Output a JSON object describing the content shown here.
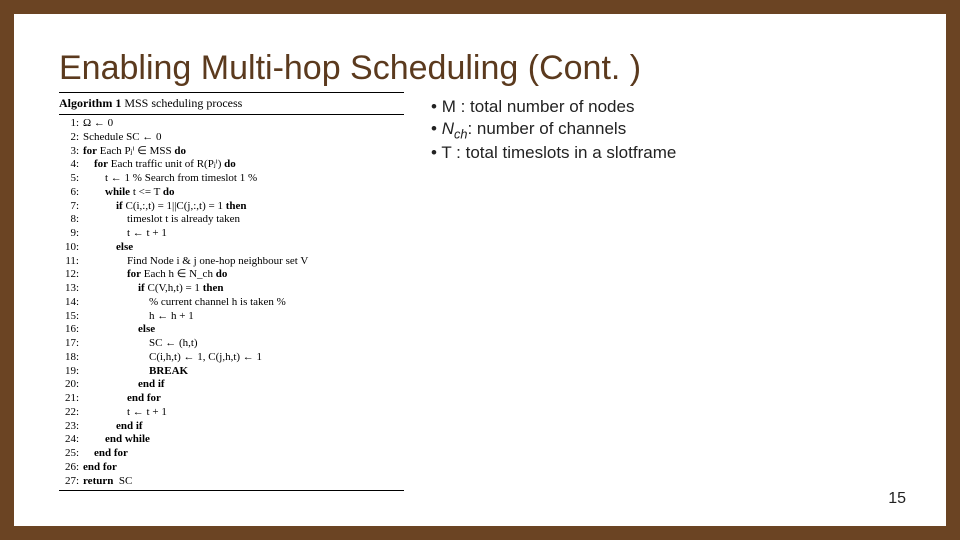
{
  "title": "Enabling Multi-hop Scheduling (Cont. )",
  "slide_number": "15",
  "legend": {
    "m": "M : total number of nodes",
    "nch_sym": "N",
    "nch_sub": "ch",
    "nch_rest": ": number of channels",
    "t": "T : total timeslots in a slotframe"
  },
  "algorithm": {
    "caption_bold": "Algorithm 1",
    "caption_rest": " MSS scheduling process",
    "lines": [
      {
        "n": "1:",
        "i": 0,
        "t": "Ω ← 0"
      },
      {
        "n": "2:",
        "i": 0,
        "t": "Schedule SC ← 0"
      },
      {
        "n": "3:",
        "i": 0,
        "pre": "for",
        "mid": " Each Pⱼⁱ ∈ MSS ",
        "post": "do"
      },
      {
        "n": "4:",
        "i": 1,
        "pre": "for",
        "mid": " Each traffic unit of R(Pⱼⁱ) ",
        "post": "do"
      },
      {
        "n": "5:",
        "i": 2,
        "t": "t ← 1 % Search from timeslot 1 %"
      },
      {
        "n": "6:",
        "i": 2,
        "pre": "while",
        "mid": " t <= T ",
        "post": "do"
      },
      {
        "n": "7:",
        "i": 3,
        "pre": "if",
        "mid": " C(i,:,t) = 1||C(j,:,t) = 1 ",
        "post": "then"
      },
      {
        "n": "8:",
        "i": 4,
        "t": "timeslot t is already taken"
      },
      {
        "n": "9:",
        "i": 4,
        "t": "t ← t + 1"
      },
      {
        "n": "10:",
        "i": 3,
        "pre": "else",
        "mid": "",
        "post": ""
      },
      {
        "n": "11:",
        "i": 4,
        "t": "Find Node i & j one-hop neighbour set V"
      },
      {
        "n": "12:",
        "i": 4,
        "pre": "for",
        "mid": " Each h ∈ N_ch ",
        "post": "do"
      },
      {
        "n": "13:",
        "i": 5,
        "pre": "if",
        "mid": " C(V,h,t) = 1 ",
        "post": "then"
      },
      {
        "n": "14:",
        "i": 6,
        "t": "% current channel h is taken %"
      },
      {
        "n": "15:",
        "i": 6,
        "t": "h ← h + 1"
      },
      {
        "n": "16:",
        "i": 5,
        "pre": "else",
        "mid": "",
        "post": ""
      },
      {
        "n": "17:",
        "i": 6,
        "t": "SC ← (h,t)"
      },
      {
        "n": "18:",
        "i": 6,
        "t": "C(i,h,t) ← 1, C(j,h,t) ← 1"
      },
      {
        "n": "19:",
        "i": 6,
        "pre": "BREAK",
        "mid": "",
        "post": ""
      },
      {
        "n": "20:",
        "i": 5,
        "pre": "end if",
        "mid": "",
        "post": ""
      },
      {
        "n": "21:",
        "i": 4,
        "pre": "end for",
        "mid": "",
        "post": ""
      },
      {
        "n": "22:",
        "i": 4,
        "t": "t ← t + 1"
      },
      {
        "n": "23:",
        "i": 3,
        "pre": "end if",
        "mid": "",
        "post": ""
      },
      {
        "n": "24:",
        "i": 2,
        "pre": "end while",
        "mid": "",
        "post": ""
      },
      {
        "n": "25:",
        "i": 1,
        "pre": "end for",
        "mid": "",
        "post": ""
      },
      {
        "n": "26:",
        "i": 0,
        "pre": "end for",
        "mid": "",
        "post": ""
      },
      {
        "n": "27:",
        "i": 0,
        "pre": "return",
        "mid": "  SC",
        "post": ""
      }
    ]
  }
}
